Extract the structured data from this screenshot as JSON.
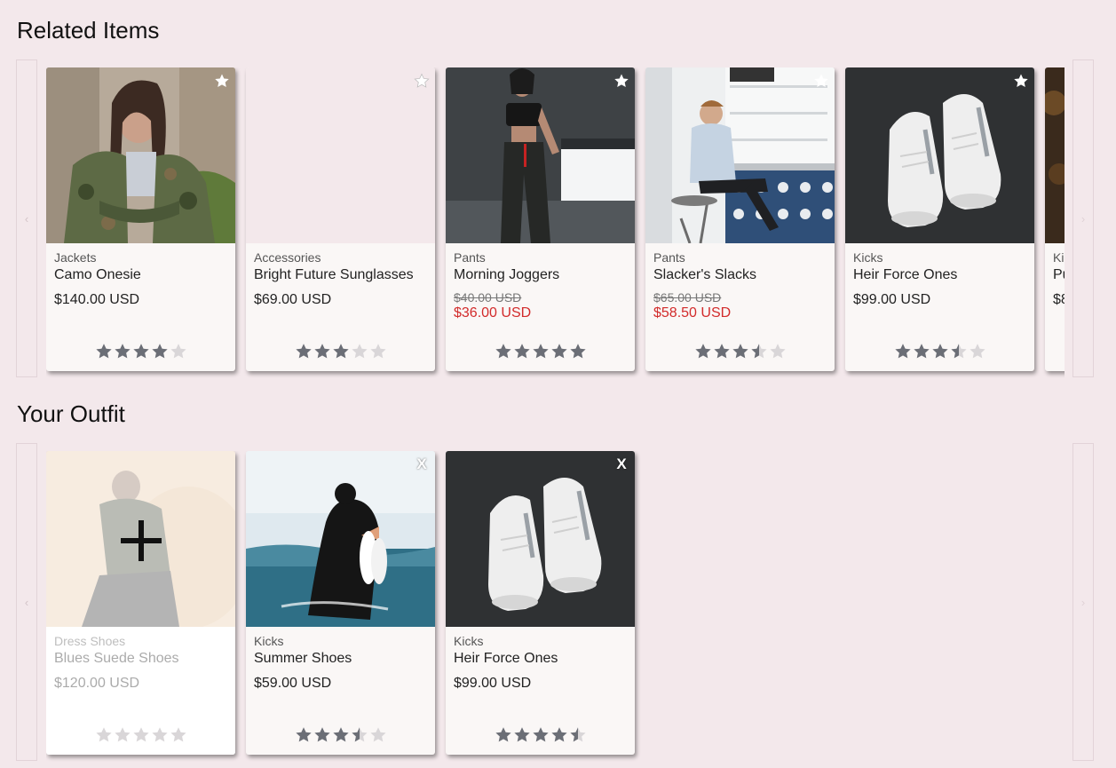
{
  "related": {
    "title": "Related Items",
    "prev_arrow": "‹",
    "next_arrow": "›",
    "cards": [
      {
        "category": "Jackets",
        "name": "Camo Onesie",
        "price": "$140.00 USD",
        "sale_price": null,
        "rating": 4,
        "image": "woman in camo jacket",
        "action_icon": "star-icon"
      },
      {
        "category": "Accessories",
        "name": "Bright Future Sunglasses",
        "price": "$69.00 USD",
        "sale_price": null,
        "rating": 3,
        "image": "",
        "action_icon": "star-icon"
      },
      {
        "category": "Pants",
        "name": "Morning Joggers",
        "price": "$40.00 USD",
        "sale_price": "$36.00 USD",
        "rating": 5,
        "image": "woman in black joggers",
        "action_icon": "star-icon"
      },
      {
        "category": "Pants",
        "name": "Slacker's Slacks",
        "price": "$65.00 USD",
        "sale_price": "$58.50 USD",
        "rating": 3.5,
        "image": "man sitting at bar",
        "action_icon": "star-icon"
      },
      {
        "category": "Kicks",
        "name": "Heir Force Ones",
        "price": "$99.00 USD",
        "sale_price": null,
        "rating": 3.5,
        "image": "white sneakers",
        "action_icon": "star-icon"
      },
      {
        "category": "Ki",
        "name": "Pu",
        "price": "$8",
        "sale_price": null,
        "rating": 0,
        "image": "dark autumn photo",
        "action_icon": "star-icon"
      }
    ]
  },
  "outfit": {
    "title": "Your Outfit",
    "prev_arrow": "‹",
    "next_arrow": "›",
    "add_card": {
      "category": "Dress Shoes",
      "name": "Blues Suede Shoes",
      "price": "$120.00 USD",
      "rating": 0,
      "icon": "plus-icon"
    },
    "cards": [
      {
        "category": "Kicks",
        "name": "Summer Shoes",
        "price": "$59.00 USD",
        "rating": 3.5,
        "image": "person wading in sea holding sneakers",
        "remove_label": "X"
      },
      {
        "category": "Kicks",
        "name": "Heir Force Ones",
        "price": "$99.00 USD",
        "rating": 4.5,
        "image": "white sneakers",
        "remove_label": "X"
      }
    ]
  },
  "colors": {
    "background": "#f3e8eb",
    "card": "#faf7f6",
    "star_filled": "#6b6e76",
    "star_empty": "#d9d6d8",
    "sale_red": "#d22b2b"
  }
}
